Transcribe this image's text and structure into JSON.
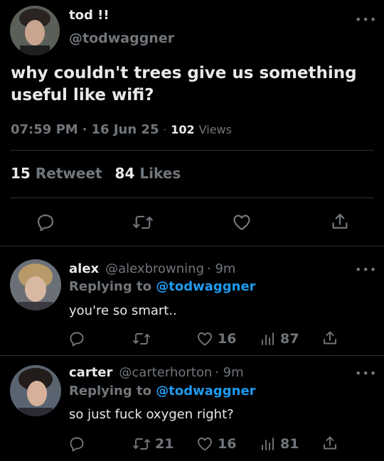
{
  "main_tweet": {
    "display_name": "tod !!",
    "handle": "@todwaggner",
    "text_line1": "why couldn't trees give us something",
    "text_line2": "useful like wifi?",
    "time": "07:59 PM",
    "separator": "·",
    "date": "16 Jun 25",
    "views_count": "102",
    "views_label": "Views",
    "retweets_count": "15",
    "retweets_label": "Retweet",
    "likes_count": "84",
    "likes_label": "Likes"
  },
  "replies": [
    {
      "display_name": "alex",
      "handle": "@alexbrowning",
      "time": "· 9m",
      "replying_label": "Replying to",
      "replying_handle": "@todwaggner",
      "text": "you're so smart..",
      "retweets": "",
      "likes": "16",
      "views": "87"
    },
    {
      "display_name": "carter",
      "handle": "@carterhorton",
      "time": "· 9m",
      "replying_label": "Replying to",
      "replying_handle": "@todwaggner",
      "text": "so just fuck oxygen right?",
      "retweets": "21",
      "likes": "16",
      "views": "81"
    }
  ],
  "more_glyph": "•••",
  "colors": {
    "background": "#000000",
    "text": "#e7e9ea",
    "secondary": "#71767b",
    "link": "#1d9bf0",
    "divider": "#2f3336"
  }
}
